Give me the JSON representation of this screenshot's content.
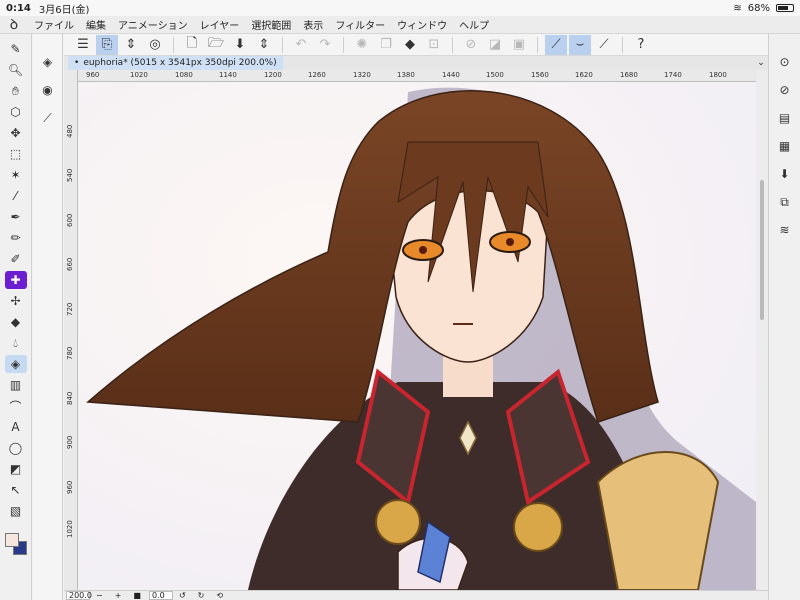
{
  "status": {
    "time": "0:14",
    "date": "3月6日(金)",
    "battery": "68%"
  },
  "menu": [
    "ファイル",
    "編集",
    "アニメーション",
    "レイヤー",
    "選択範囲",
    "表示",
    "フィルター",
    "ウィンドウ",
    "ヘルプ"
  ],
  "document": {
    "tab_title": "euphoria* (5015 x 3541px 350dpi 200.0%)"
  },
  "ruler": {
    "h": [
      "960",
      "1020",
      "1080",
      "1140",
      "1200",
      "1260",
      "1320",
      "1380",
      "1440",
      "1500",
      "1560",
      "1620",
      "1680",
      "1740",
      "1800"
    ],
    "v": [
      "480",
      "540",
      "600",
      "660",
      "720",
      "780",
      "840",
      "900",
      "960",
      "1020"
    ]
  },
  "bottom": {
    "zoom": "200.0",
    "angle": "0.0"
  },
  "colors": {
    "accent": "#c5d9f1",
    "fg_color": "#f6e6df",
    "bg_color": "#2a3a8a",
    "hair": "#6b3a1f",
    "coat": "#3e2c2a",
    "trim": "#c8252f"
  }
}
